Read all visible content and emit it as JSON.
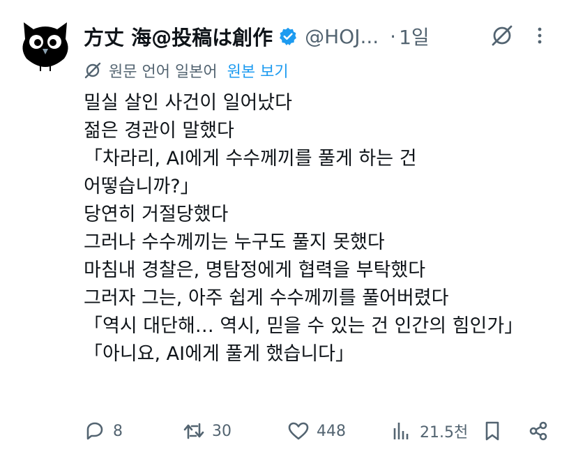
{
  "tweet": {
    "author_name": "方丈 海@投稿は創作",
    "handle": "@HOJ...",
    "dot": "·",
    "time": "1일",
    "translation_note": "원문 언어 일본어",
    "translation_link": "원본 보기",
    "lines": [
      "밀실 살인 사건이 일어났다",
      "젊은 경관이 말했다",
      "「차라리, AI에게 수수께끼를 풀게 하는 건",
      "어떻습니까?」",
      "당연히 거절당했다",
      "그러나 수수께끼는 누구도 풀지 못했다",
      "마침내 경찰은, 명탐정에게 협력을 부탁했다",
      "그러자 그는, 아주 쉽게 수수께끼를 풀어버렸다",
      "「역시 대단해… 역시, 믿을 수 있는 건 인간의 힘인가」",
      "「아니요, AI에게 풀게 했습니다」"
    ]
  },
  "actions": {
    "replies": "8",
    "reposts": "30",
    "likes": "448",
    "views": "21.5천"
  },
  "colors": {
    "text": "#0f1419",
    "muted": "#536471",
    "accent": "#1d9bf0"
  },
  "icons": [
    "owl-avatar",
    "verified-badge-icon",
    "grok-icon",
    "more-icon",
    "translate-icon",
    "reply-icon",
    "repost-icon",
    "like-icon",
    "views-icon",
    "bookmark-icon",
    "share-icon"
  ]
}
